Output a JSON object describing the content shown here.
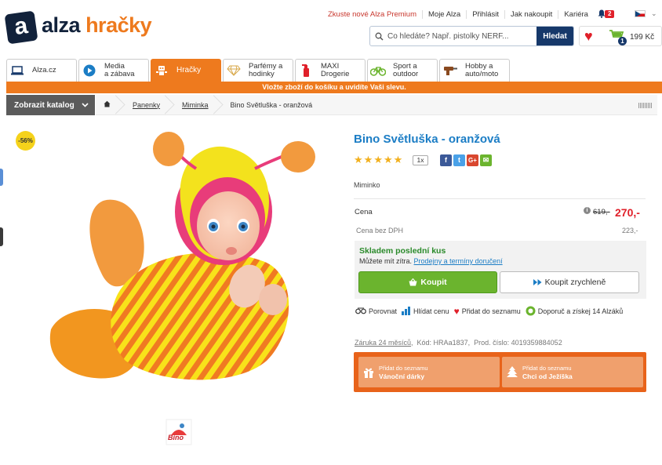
{
  "top_links": [
    "Zkuste nové Alza Premium",
    "Moje Alza",
    "Přihlásit",
    "Jak nakoupit",
    "Kariéra"
  ],
  "notification_count": "2",
  "logo": {
    "mark": "a",
    "word1": "alza",
    "word2": "hračky"
  },
  "search": {
    "placeholder": "Co hledáte? Např. pistolky NERF...",
    "button": "Hledat"
  },
  "cart": {
    "count": "1",
    "price": "199 Kč"
  },
  "categories": [
    {
      "label1": "Alza.cz",
      "label2": ""
    },
    {
      "label1": "Media",
      "label2": "a zábava"
    },
    {
      "label1": "Hračky",
      "label2": ""
    },
    {
      "label1": "Parfémy a",
      "label2": "hodinky"
    },
    {
      "label1": "MAXI",
      "label2": "Drogerie"
    },
    {
      "label1": "Sport a",
      "label2": "outdoor"
    },
    {
      "label1": "Hobby a",
      "label2": "auto/moto"
    }
  ],
  "promo_bar": "Vložte zboží do košíku a uvidíte Vaši slevu.",
  "catalog_button": "Zobrazit katalog",
  "breadcrumb": [
    "Panenky",
    "Miminka",
    "Bino Světluška - oranžová"
  ],
  "product": {
    "discount_badge": "-56%",
    "title": "Bino Světluška - oranžová",
    "rating_count": "1x",
    "brand_category": "Miminko",
    "price_label": "Cena",
    "price_old": "619,-",
    "price_now": "270,-",
    "vat_label": "Cena bez DPH",
    "vat_value": "223,-",
    "stock_title": "Skladem poslední kus",
    "stock_text": "Můžete mít zítra.",
    "stock_link": "Prodejny a termíny doručení",
    "buy_label": "Koupit",
    "buy_fast_label": "Koupit zrychleně",
    "actions": [
      "Porovnat",
      "Hlídat cenu",
      "Přidat do seznamu",
      "Doporuč a získej 14 Alzáků"
    ],
    "warranty": "Záruka 24 měsíců",
    "code": "Kód: HRAa1837,",
    "product_number": "Prod. číslo: 4019359884052",
    "wishlists": [
      {
        "small": "Přidat do seznamu",
        "big": "Vánoční dárky"
      },
      {
        "small": "Přidat do seznamu",
        "big": "Chci od Ježíška"
      }
    ],
    "thumb_brand": "Bino"
  },
  "social": [
    "f",
    "t",
    "G+",
    "✉"
  ],
  "colors": {
    "brand_orange": "#ee7a1e",
    "brand_navy": "#16386a",
    "title_blue": "#1b7dc5",
    "price_red": "#e0202a",
    "buy_green": "#6bb42e"
  }
}
